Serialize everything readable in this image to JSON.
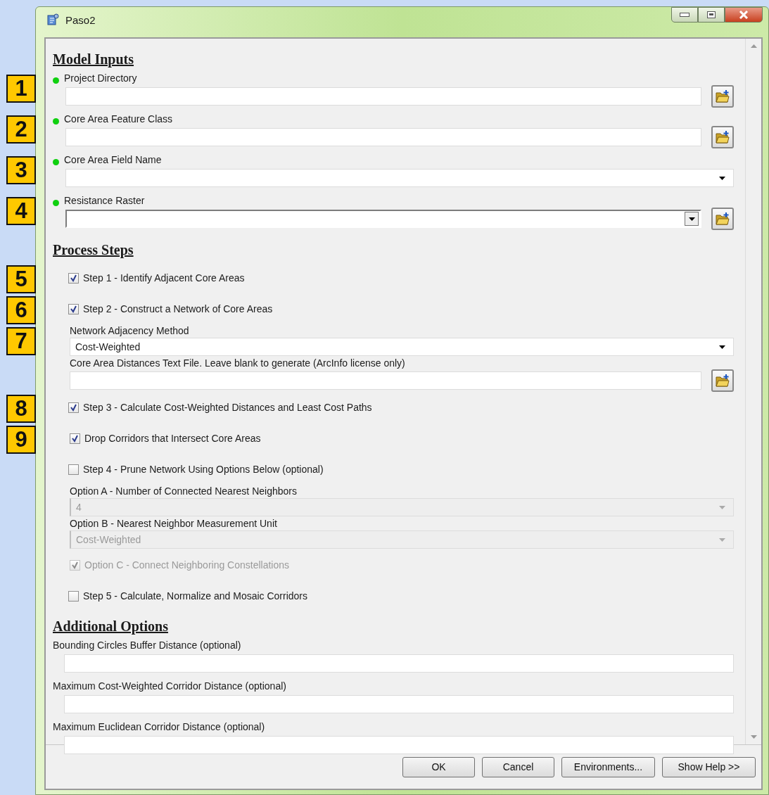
{
  "window": {
    "title": "Paso2"
  },
  "sections": [
    {
      "title": "Model Inputs",
      "items": [
        {
          "kind": "text",
          "marker": "1",
          "required": true,
          "label": "Project Directory",
          "browse": true,
          "disabled": false
        },
        {
          "kind": "text",
          "marker": "2",
          "required": true,
          "label": "Core Area Feature Class",
          "browse": true,
          "disabled": false
        },
        {
          "kind": "combo",
          "marker": "3",
          "required": true,
          "label": "Core Area Field Name",
          "browse": false,
          "disabled": false
        },
        {
          "kind": "combo",
          "marker": "4",
          "required": true,
          "label": "Resistance Raster",
          "browse": true,
          "disabled": false
        }
      ]
    },
    {
      "title": "Process Steps",
      "items": [
        {
          "kind": "check",
          "marker": "5",
          "label": "Step 1 - Identify Adjacent Core Areas",
          "checked": true,
          "disabled": false
        },
        {
          "kind": "check",
          "marker": "6",
          "label": "Step 2 - Construct a Network of Core Areas",
          "checked": true,
          "disabled": false,
          "children": [
            {
              "kind": "combo",
              "marker": "7",
              "required": false,
              "label": "Network Adjacency Method",
              "browse": false,
              "disabled": false,
              "value": "Cost-Weighted"
            },
            {
              "kind": "text",
              "required": false,
              "label": "Core Area Distances Text File. Leave blank to generate (ArcInfo license only)",
              "browse": true,
              "disabled": false
            }
          ]
        },
        {
          "kind": "check",
          "marker": "8",
          "label": "Step 3 - Calculate Cost-Weighted Distances and Least Cost Paths",
          "checked": true,
          "disabled": false,
          "children": [
            {
              "kind": "check",
              "marker": "9",
              "label": "Drop Corridors that Intersect Core Areas",
              "checked": true,
              "disabled": false
            }
          ]
        },
        {
          "kind": "check",
          "label": "Step 4 - Prune Network Using Options Below (optional)",
          "checked": false,
          "disabled": false,
          "children": [
            {
              "kind": "combo",
              "required": false,
              "label": "Option A - Number of Connected Nearest Neighbors",
              "browse": false,
              "disabled": true,
              "value": "4"
            },
            {
              "kind": "combo",
              "required": false,
              "label": "Option B - Nearest Neighbor Measurement Unit",
              "browse": false,
              "disabled": true,
              "value": "Cost-Weighted"
            },
            {
              "kind": "check",
              "label": "Option C - Connect Neighboring Constellations",
              "checked": true,
              "disabled": true
            }
          ]
        },
        {
          "kind": "check",
          "label": "Step 5 - Calculate, Normalize and Mosaic Corridors",
          "checked": false,
          "disabled": false
        }
      ]
    },
    {
      "title": "Additional Options",
      "items": [
        {
          "kind": "text",
          "required": false,
          "label": "Bounding Circles Buffer Distance (optional)",
          "browse": false,
          "disabled": false
        },
        {
          "kind": "text",
          "required": false,
          "label": "Maximum Cost-Weighted Corridor Distance (optional)",
          "browse": false,
          "disabled": false
        },
        {
          "kind": "text",
          "required": false,
          "label": "Maximum Euclidean Corridor Distance (optional)",
          "browse": false,
          "disabled": false
        }
      ]
    }
  ],
  "buttons": [
    "OK",
    "Cancel",
    "Environments...",
    "Show Help >>"
  ]
}
